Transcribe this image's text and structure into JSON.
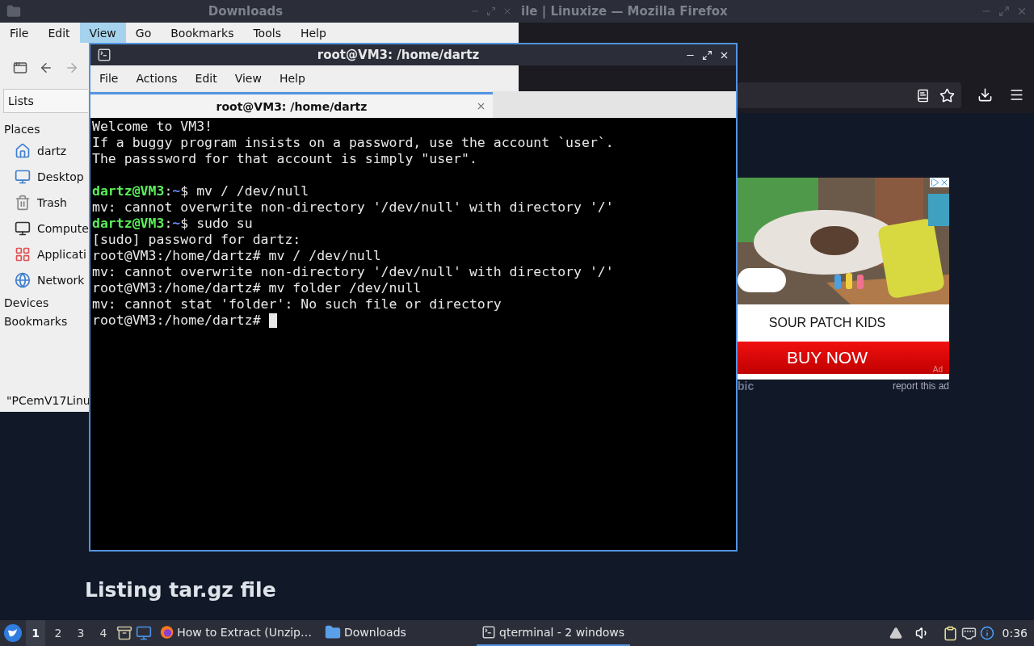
{
  "firefox": {
    "title": "ile | Linuxize — Mozilla Firefox",
    "ad": {
      "kind": "picture",
      "brand": "SOUR PATCH KIDS",
      "button": "BUY NOW",
      "badge": "Ad"
    },
    "report_link": "report this ad",
    "fragment_1": "bic",
    "heading": "Listing tar.gz file"
  },
  "file_manager": {
    "title": "Downloads",
    "menu": [
      {
        "label": "File",
        "selected": false
      },
      {
        "label": "Edit",
        "selected": false
      },
      {
        "label": "View",
        "selected": true
      },
      {
        "label": "Go",
        "selected": false
      },
      {
        "label": "Bookmarks",
        "selected": false
      },
      {
        "label": "Tools",
        "selected": false
      },
      {
        "label": "Help",
        "selected": false
      }
    ],
    "view_selector": "Lists",
    "sidebar": [
      {
        "label": "Places",
        "items": [
          {
            "label": "dartz",
            "kind": "home"
          },
          {
            "label": "Desktop",
            "kind": "desktop"
          },
          {
            "label": "Trash",
            "kind": "trash"
          },
          {
            "label": "Compute",
            "kind": "computer"
          },
          {
            "label": "Applicati",
            "kind": "apps"
          },
          {
            "label": "Network",
            "kind": "network"
          }
        ]
      },
      {
        "label": "Devices"
      },
      {
        "label": "Bookmarks"
      }
    ],
    "status_bar": "\"PCemV17Linu"
  },
  "terminal": {
    "title": "root@VM3: /home/dartz",
    "menu": [
      "File",
      "Actions",
      "Edit",
      "View",
      "Help"
    ],
    "tabs": [
      {
        "label": "root@VM3: /home/dartz",
        "selected": true
      }
    ],
    "lines": [
      {
        "kind": "output",
        "text": "Welcome to VM3!"
      },
      {
        "kind": "output",
        "text": "If a buggy program insists on a password, use the account `user`."
      },
      {
        "kind": "output",
        "text": "The passsword for that account is simply \"user\"."
      },
      {
        "kind": "blank"
      },
      {
        "kind": "prompt",
        "user": "dartz@VM3",
        "sep": ":",
        "path": "~",
        "command": "$ mv / /dev/null"
      },
      {
        "kind": "output",
        "text": "mv: cannot overwrite non-directory '/dev/null' with directory '/'"
      },
      {
        "kind": "prompt",
        "user": "dartz@VM3",
        "sep": ":",
        "path": "~",
        "command": "$ sudo su"
      },
      {
        "kind": "output",
        "text": "[sudo] password for dartz:"
      },
      {
        "kind": "output",
        "text": "root@VM3:/home/dartz# mv / /dev/null"
      },
      {
        "kind": "output",
        "text": "mv: cannot overwrite non-directory '/dev/null' with directory '/'"
      },
      {
        "kind": "output",
        "text": "root@VM3:/home/dartz# mv folder /dev/null"
      },
      {
        "kind": "output",
        "text": "mv: cannot stat 'folder': No such file or directory"
      },
      {
        "kind": "output",
        "text": "root@VM3:/home/dartz#",
        "cursor": true
      }
    ]
  },
  "taskbar": {
    "desktops": [
      {
        "label": "1",
        "selected": true
      },
      {
        "label": "2",
        "selected": false
      },
      {
        "label": "3",
        "selected": false
      },
      {
        "label": "4",
        "selected": false
      }
    ],
    "tasks": [
      {
        "kind": "firefox",
        "label": "How to Extract (Unzip…",
        "selected": false
      },
      {
        "kind": "folder",
        "label": "Downloads",
        "selected": false
      },
      {
        "kind": "terminal",
        "label": "qterminal - 2 windows",
        "selected": true
      }
    ],
    "clock": "0:36"
  }
}
